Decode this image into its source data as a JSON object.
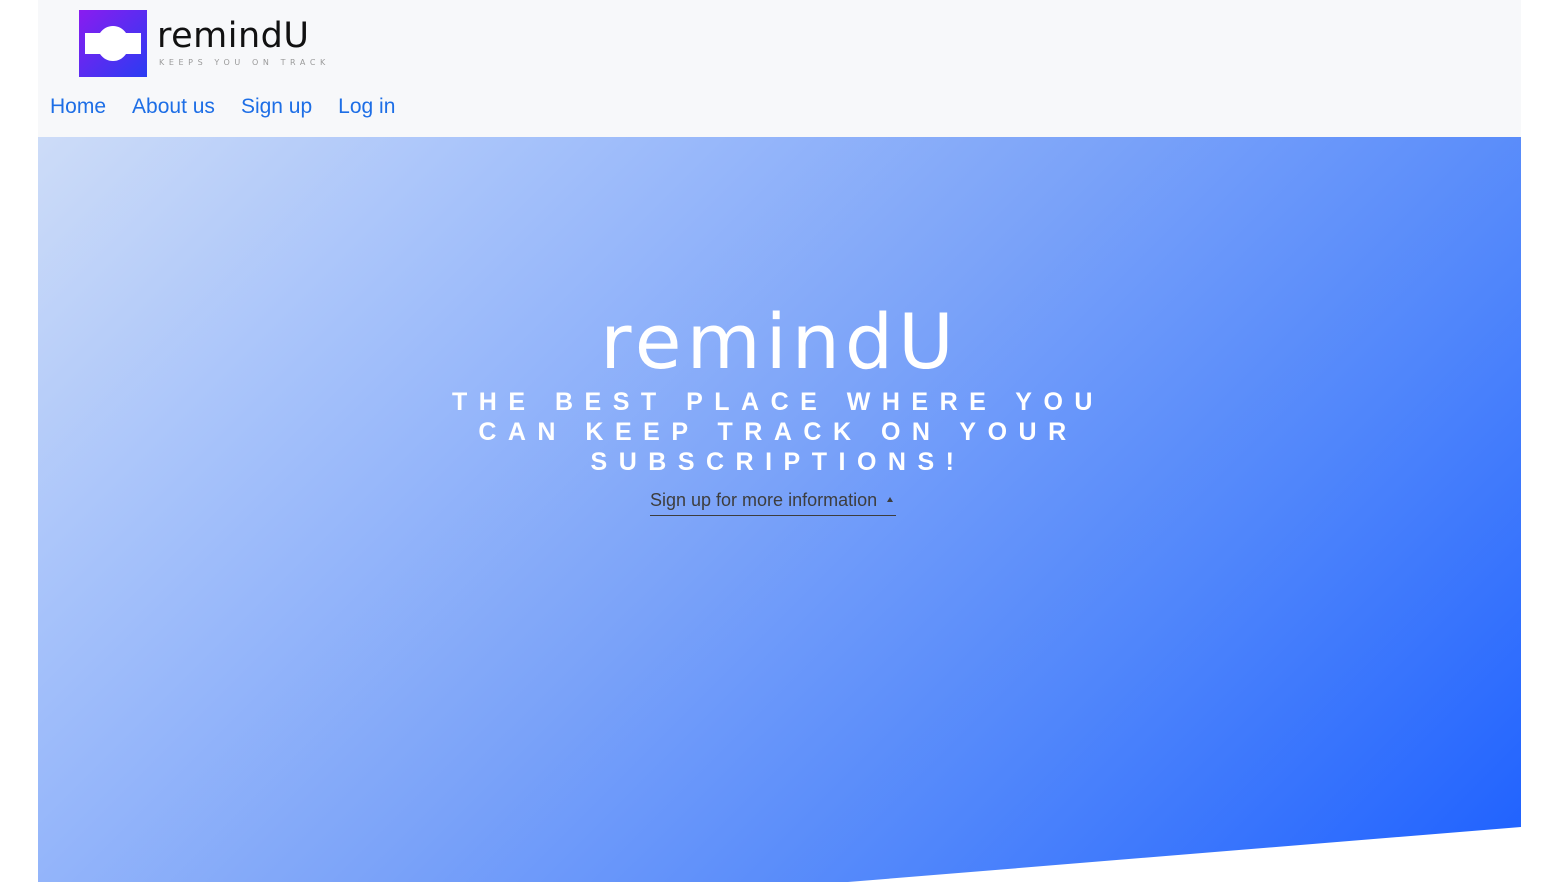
{
  "brand": {
    "name": "remindU",
    "tagline": "KEEPS YOU ON TRACK",
    "logo_colors": [
      "#8a1cf0",
      "#2a3cf2"
    ]
  },
  "nav": {
    "items": [
      {
        "label": "Home"
      },
      {
        "label": "About us"
      },
      {
        "label": "Sign up"
      },
      {
        "label": "Log in"
      }
    ],
    "link_color": "#1d6ee6"
  },
  "hero": {
    "title": "remindU",
    "subtitle": "THE BEST PLACE WHERE YOU CAN KEEP TRACK ON YOUR SUBSCRIPTIONS!",
    "cta_label": "Sign up for more information",
    "cta_icon": "caret-up-icon",
    "gradient_colors": [
      "#cddcf8",
      "#1d60ff"
    ]
  }
}
